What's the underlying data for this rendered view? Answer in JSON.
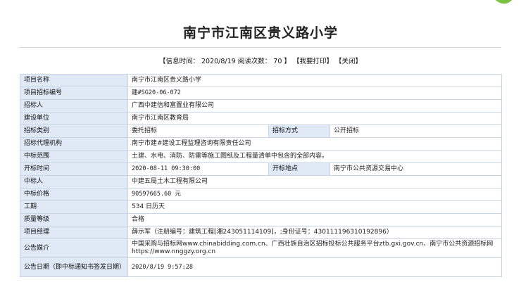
{
  "title": "南宁市江南区贵义路小学",
  "meta": {
    "info_time_label": "【信息时间：",
    "info_time": "2020/8/19",
    "read_label": "阅读次数：",
    "read_count": "70",
    "close_bracket": "】",
    "print_label": "【我要打印】",
    "close_label": "【关闭】"
  },
  "rows": {
    "project_name": {
      "label": "项目名称",
      "value": "南宁市江南区贵义路小学"
    },
    "project_code": {
      "label": "项目招标编号",
      "value": "建#SG20-06-072"
    },
    "tenderer": {
      "label": "招标人",
      "value": "广西中建信和富置业有限公司"
    },
    "construction_unit": {
      "label": "建设单位",
      "value": "南宁市江南区教育局"
    },
    "tender_type": {
      "label": "招标类别",
      "value": "委托招标",
      "label2": "招标方式",
      "value2": "公开招标"
    },
    "agency": {
      "label": "招标代理机构",
      "value": "南宁市建#建设工程监理咨询有限责任公司"
    },
    "scope": {
      "label": "中标范围",
      "value": "土建、水电、消防、防雷等施工图纸及工程量清单中包含的全部内容。"
    },
    "open_time": {
      "label": "开标时间",
      "value": "2020-08-11 09:30:00",
      "label2": "开标地点",
      "value2": "南宁市公共资源交易中心"
    },
    "winner": {
      "label": "中标人",
      "value": "中建五局土木工程有限公司"
    },
    "price": {
      "label": "中标价格",
      "value": "90597665.60 元"
    },
    "duration": {
      "label": "工期",
      "value": "534 日历天"
    },
    "quality": {
      "label": "质量等级",
      "value": "合格"
    },
    "manager": {
      "label": "项目经理",
      "value": "薛示军（注册编号：建筑工程[湘243051114109]，;身份证号：430111196310192896）"
    },
    "media": {
      "label": "公告媒介",
      "value": "中国采购与招标网www.chinabidding.com.cn、广西壮族自治区招标投标公共服务平台ztb.gxi.gov.cn、南宁市公共资源招标网https://www.nnggzy.org.cn"
    },
    "announce_date": {
      "label": "公告日期（即中标通知书签发日期）",
      "value": "2020/8/19 9:57:28"
    }
  },
  "colors": {
    "label_bg": "#dfeaf6",
    "border": "#c9d6e6",
    "leaf": "#7cc242"
  },
  "icons": {
    "corner": "leaf-icon"
  }
}
